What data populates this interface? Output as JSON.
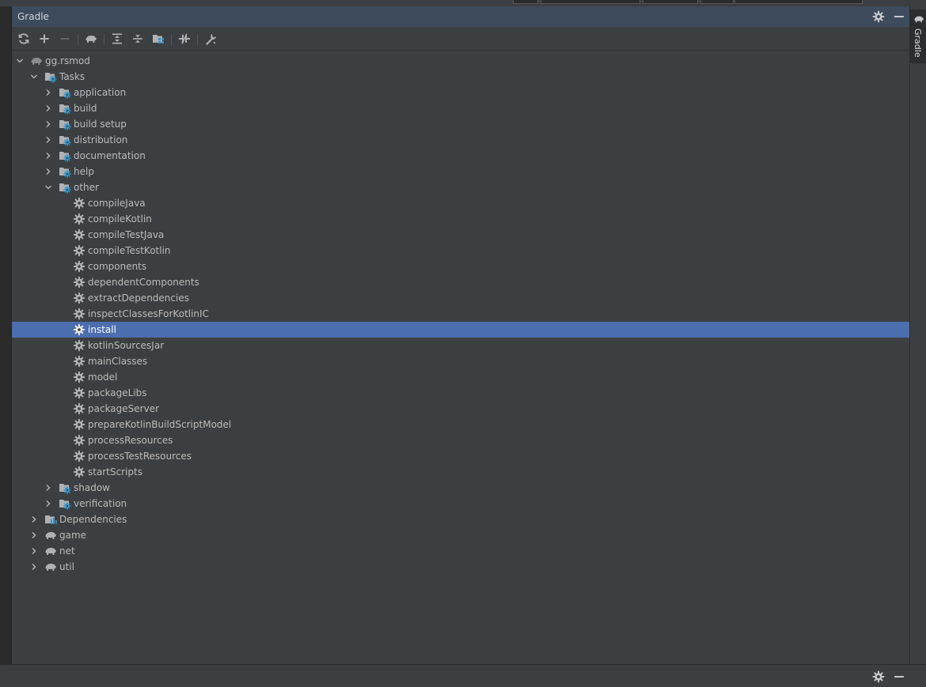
{
  "panel": {
    "title": "Gradle"
  },
  "sidebar": {
    "tab_label": "Gradle"
  },
  "tree": {
    "rows": [
      {
        "label": "gg.rsmod",
        "icon": "elephant-icon",
        "expander": "expanded",
        "depth": 0
      },
      {
        "label": "Tasks",
        "icon": "task-folder-icon",
        "expander": "expanded",
        "depth": 1
      },
      {
        "label": "application",
        "icon": "task-folder-icon",
        "expander": "collapsed",
        "depth": 2
      },
      {
        "label": "build",
        "icon": "task-folder-icon",
        "expander": "collapsed",
        "depth": 2
      },
      {
        "label": "build setup",
        "icon": "task-folder-icon",
        "expander": "collapsed",
        "depth": 2
      },
      {
        "label": "distribution",
        "icon": "task-folder-icon",
        "expander": "collapsed",
        "depth": 2
      },
      {
        "label": "documentation",
        "icon": "task-folder-icon",
        "expander": "collapsed",
        "depth": 2
      },
      {
        "label": "help",
        "icon": "task-folder-icon",
        "expander": "collapsed",
        "depth": 2
      },
      {
        "label": "other",
        "icon": "task-folder-icon",
        "expander": "expanded",
        "depth": 2
      },
      {
        "label": "compileJava",
        "icon": "gear-icon",
        "expander": "none",
        "depth": 3
      },
      {
        "label": "compileKotlin",
        "icon": "gear-icon",
        "expander": "none",
        "depth": 3
      },
      {
        "label": "compileTestJava",
        "icon": "gear-icon",
        "expander": "none",
        "depth": 3
      },
      {
        "label": "compileTestKotlin",
        "icon": "gear-icon",
        "expander": "none",
        "depth": 3
      },
      {
        "label": "components",
        "icon": "gear-icon",
        "expander": "none",
        "depth": 3
      },
      {
        "label": "dependentComponents",
        "icon": "gear-icon",
        "expander": "none",
        "depth": 3
      },
      {
        "label": "extractDependencies",
        "icon": "gear-icon",
        "expander": "none",
        "depth": 3
      },
      {
        "label": "inspectClassesForKotlinIC",
        "icon": "gear-icon",
        "expander": "none",
        "depth": 3
      },
      {
        "label": "install",
        "icon": "gear-icon",
        "expander": "none",
        "depth": 3,
        "selected": true
      },
      {
        "label": "kotlinSourcesJar",
        "icon": "gear-icon",
        "expander": "none",
        "depth": 3
      },
      {
        "label": "mainClasses",
        "icon": "gear-icon",
        "expander": "none",
        "depth": 3
      },
      {
        "label": "model",
        "icon": "gear-icon",
        "expander": "none",
        "depth": 3
      },
      {
        "label": "packageLibs",
        "icon": "gear-icon",
        "expander": "none",
        "depth": 3
      },
      {
        "label": "packageServer",
        "icon": "gear-icon",
        "expander": "none",
        "depth": 3
      },
      {
        "label": "prepareKotlinBuildScriptModel",
        "icon": "gear-icon",
        "expander": "none",
        "depth": 3
      },
      {
        "label": "processResources",
        "icon": "gear-icon",
        "expander": "none",
        "depth": 3
      },
      {
        "label": "processTestResources",
        "icon": "gear-icon",
        "expander": "none",
        "depth": 3
      },
      {
        "label": "startScripts",
        "icon": "gear-icon",
        "expander": "none",
        "depth": 3
      },
      {
        "label": "shadow",
        "icon": "task-folder-icon",
        "expander": "collapsed",
        "depth": 2
      },
      {
        "label": "verification",
        "icon": "task-folder-icon",
        "expander": "collapsed",
        "depth": 2
      },
      {
        "label": "Dependencies",
        "icon": "dependencies-icon",
        "expander": "collapsed",
        "depth": 1
      },
      {
        "label": "game",
        "icon": "elephant-icon",
        "expander": "collapsed",
        "depth": 1
      },
      {
        "label": "net",
        "icon": "elephant-icon",
        "expander": "collapsed",
        "depth": 1
      },
      {
        "label": "util",
        "icon": "elephant-icon",
        "expander": "collapsed",
        "depth": 1
      }
    ]
  },
  "colors": {
    "panel_bg": "#3c3f41",
    "title_bar_bg": "#3d4b5c",
    "selection_bg": "#4b6eaf",
    "icon_gray": "#afb1b3",
    "icon_blue": "#3592c4"
  }
}
